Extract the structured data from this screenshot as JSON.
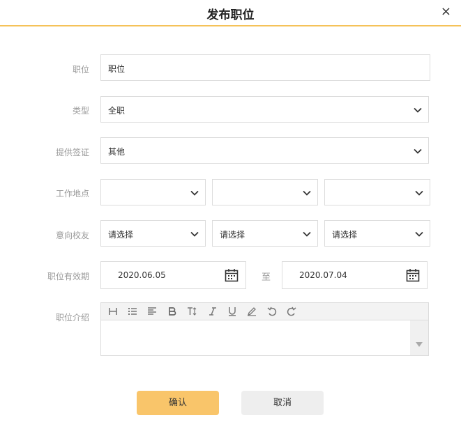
{
  "dialog": {
    "title": "发布职位",
    "close_symbol": "×"
  },
  "form": {
    "position": {
      "label": "职位",
      "value": "职位"
    },
    "type": {
      "label": "类型",
      "value": "全职"
    },
    "visa": {
      "label": "提供签证",
      "value": "其他"
    },
    "location": {
      "label": "工作地点",
      "values": [
        "",
        "",
        ""
      ]
    },
    "school": {
      "label": "意向校友",
      "values": [
        "请选择",
        "请选择",
        "请选择"
      ]
    },
    "validity": {
      "label": "职位有效期",
      "start": "2020.06.05",
      "separator": "至",
      "end": "2020.07.04"
    },
    "intro": {
      "label": "职位介绍",
      "value": ""
    }
  },
  "toolbar_icons": [
    "heading-icon",
    "bullet-list-icon",
    "align-icon",
    "bold-icon",
    "text-size-icon",
    "italic-icon",
    "underline-icon",
    "pen-icon",
    "undo-icon",
    "redo-icon"
  ],
  "actions": {
    "confirm": "确认",
    "cancel": "取消"
  },
  "colors": {
    "accent": "#f5c259",
    "confirm_bg": "#f9c56a",
    "cancel_bg": "#eeeeee",
    "label": "#999999",
    "border": "#dcdcdc"
  }
}
